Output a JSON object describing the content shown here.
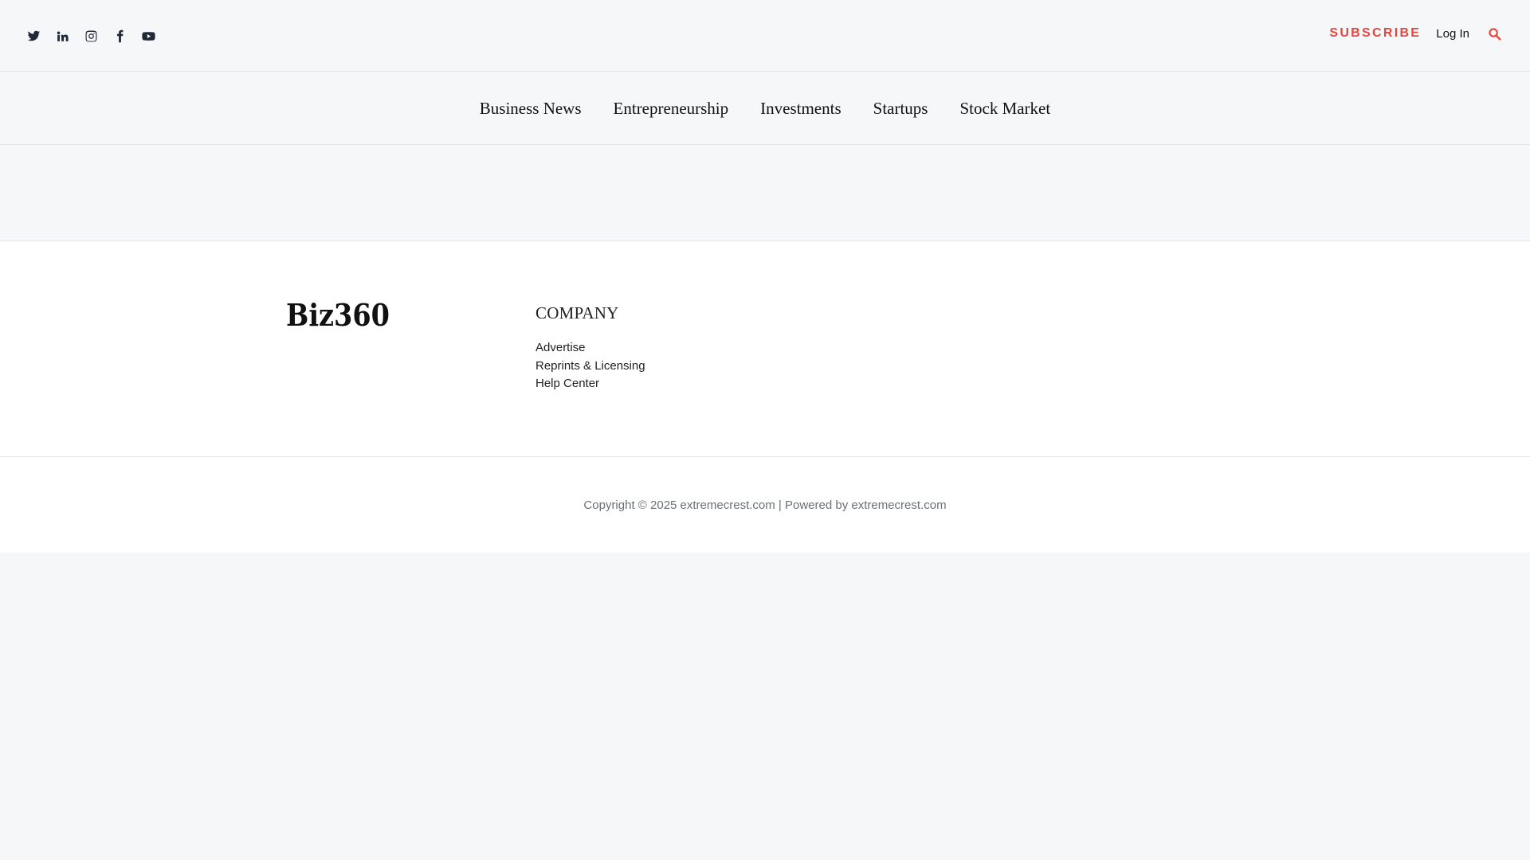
{
  "header": {
    "social_icons": [
      "twitter-icon",
      "linkedin-icon",
      "instagram-icon",
      "facebook-icon",
      "youtube-icon"
    ],
    "subscribe_label": "SUBSCRIBE",
    "login_label": "Log In",
    "search_icon": "search-icon"
  },
  "nav": {
    "items": [
      {
        "label": "Business News"
      },
      {
        "label": "Entrepreneurship"
      },
      {
        "label": "Investments"
      },
      {
        "label": "Startups"
      },
      {
        "label": "Stock Market"
      }
    ]
  },
  "footer": {
    "logo_text": "Biz360",
    "company": {
      "heading": "COMPANY",
      "links": [
        {
          "label": "Advertise"
        },
        {
          "label": "Reprints & Licensing"
        },
        {
          "label": "Help Center"
        }
      ]
    },
    "copyright": {
      "prefix": "Copyright © 2025 ",
      "site": "extremecrest.com",
      "separator": " | Powered by ",
      "powered_by": "extremecrest.com"
    }
  },
  "colors": {
    "accent": "#e2473f",
    "page_bg": "#f6f7f9",
    "panel_bg": "#ffffff",
    "muted_text": "#6b6f76"
  }
}
